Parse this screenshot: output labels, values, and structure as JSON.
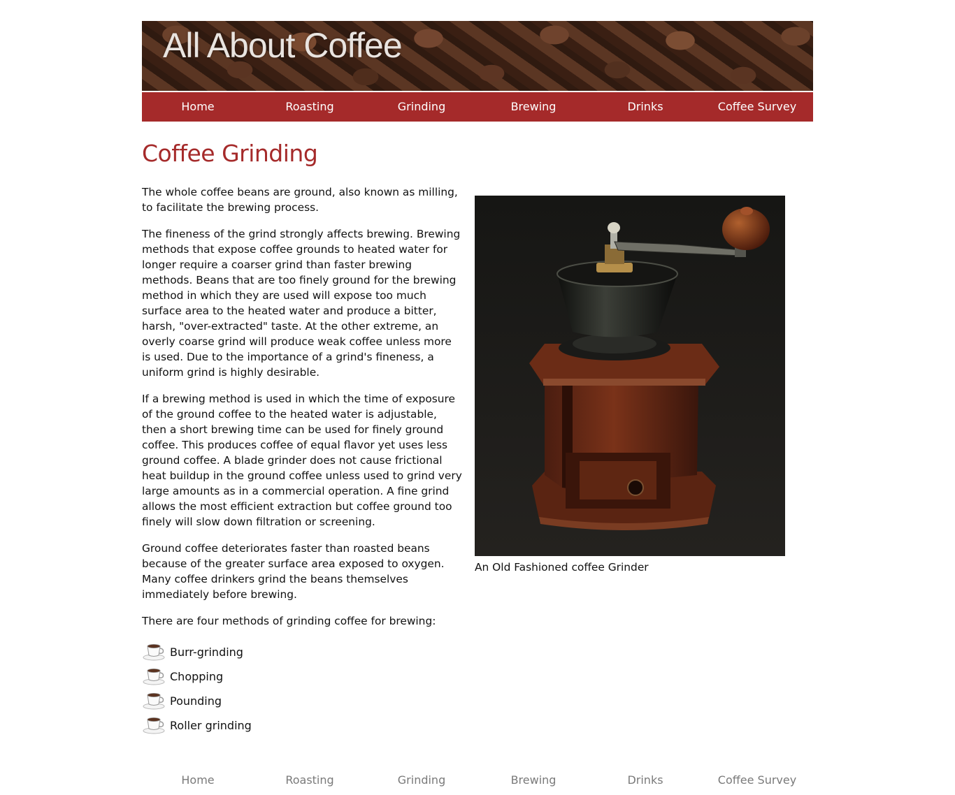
{
  "site": {
    "title": "All About Coffee"
  },
  "nav": {
    "items": [
      {
        "label": "Home"
      },
      {
        "label": "Roasting"
      },
      {
        "label": "Grinding"
      },
      {
        "label": "Brewing"
      },
      {
        "label": "Drinks"
      },
      {
        "label": "Coffee Survey"
      }
    ]
  },
  "page": {
    "heading": "Coffee Grinding",
    "paragraphs": [
      "The whole coffee beans are ground, also known as milling, to facilitate the brewing process.",
      "The fineness of the grind strongly affects brewing. Brewing methods that expose coffee grounds to heated water for longer require a coarser grind than faster brewing methods. Beans that are too finely ground for the brewing method in which they are used will expose too much surface area to the heated water and produce a bitter, harsh, \"over-extracted\" taste. At the other extreme, an overly coarse grind will produce weak coffee unless more is used. Due to the importance of a grind's fineness, a uniform grind is highly desirable.",
      "If a brewing method is used in which the time of exposure of the ground coffee to the heated water is adjustable, then a short brewing time can be used for finely ground coffee. This produces coffee of equal flavor yet uses less ground coffee. A blade grinder does not cause frictional heat buildup in the ground coffee unless used to grind very large amounts as in a commercial operation. A fine grind allows the most efficient extraction but coffee ground too finely will slow down filtration or screening.",
      "Ground coffee deteriorates faster than roasted beans because of the greater surface area exposed to oxygen. Many coffee drinkers grind the beans themselves immediately before brewing.",
      "There are four methods of grinding coffee for brewing:"
    ],
    "methods": [
      {
        "label": "Burr-grinding",
        "icon": "coffee-cup-icon"
      },
      {
        "label": "Chopping",
        "icon": "coffee-cup-icon"
      },
      {
        "label": "Pounding",
        "icon": "coffee-cup-icon"
      },
      {
        "label": "Roller grinding",
        "icon": "coffee-cup-icon"
      }
    ],
    "figure": {
      "caption": "An Old Fashioned coffee Grinder"
    }
  },
  "footer_nav": {
    "items": [
      {
        "label": "Home"
      },
      {
        "label": "Roasting"
      },
      {
        "label": "Grinding"
      },
      {
        "label": "Brewing"
      },
      {
        "label": "Drinks"
      },
      {
        "label": "Coffee Survey"
      }
    ]
  },
  "colors": {
    "accent": "#a52a2a",
    "nav_text": "#ffffff",
    "footer_link": "#7a7a7a",
    "body_text": "#111111"
  }
}
